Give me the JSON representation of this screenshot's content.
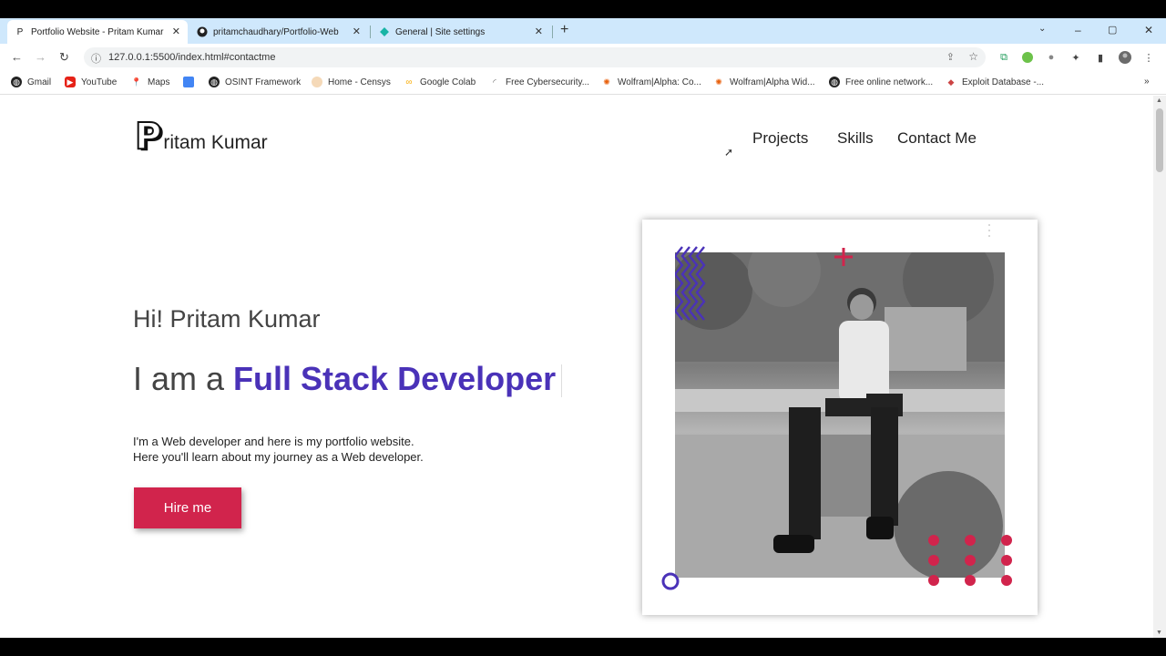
{
  "browser": {
    "tabs": [
      {
        "title": "Portfolio Website - Pritam Kumar",
        "favicon": "P"
      },
      {
        "title": "pritamchaudhary/Portfolio-Web",
        "favicon": "github-icon"
      },
      {
        "title": "General | Site settings",
        "favicon": "diamond-icon"
      }
    ],
    "new_tab_label": "+",
    "window_controls": [
      "–",
      "▢",
      "✕"
    ],
    "url": "127.0.0.1:5500/index.html#contactme",
    "bookmarks": [
      {
        "label": "Gmail",
        "icon": "globe-icon"
      },
      {
        "label": "YouTube",
        "icon": "youtube-icon"
      },
      {
        "label": "Maps",
        "icon": "maps-icon"
      },
      {
        "label": "",
        "icon": "folder-icon"
      },
      {
        "label": "OSINT Framework",
        "icon": "globe-icon"
      },
      {
        "label": "Home - Censys",
        "icon": "censys-icon"
      },
      {
        "label": "Google Colab",
        "icon": "colab-icon"
      },
      {
        "label": "Free Cybersecurity...",
        "icon": "loading-icon"
      },
      {
        "label": "Wolfram|Alpha: Co...",
        "icon": "wolfram-icon"
      },
      {
        "label": "Wolfram|Alpha Wid...",
        "icon": "wolfram-icon"
      },
      {
        "label": "Free online network...",
        "icon": "globe-icon"
      },
      {
        "label": "Exploit Database -...",
        "icon": "exploitdb-icon"
      }
    ],
    "bookmarks_more": "»"
  },
  "site": {
    "logo_letter": "P",
    "logo_text": "ritam Kumar",
    "nav": [
      "Projects",
      "Skills",
      "Contact Me"
    ],
    "greeting": "Hi! Pritam Kumar",
    "role_prefix": "I am a ",
    "role_highlight": "Full Stack Developer",
    "description_line1": "I'm a Web developer and here is my portfolio website.",
    "description_line2": "Here you'll learn about my journey as a Web developer.",
    "cta": "Hire me"
  },
  "colors": {
    "accent_purple": "#4a32b8",
    "accent_red": "#d1244c",
    "tabbar_bg": "#cfe8fc"
  }
}
